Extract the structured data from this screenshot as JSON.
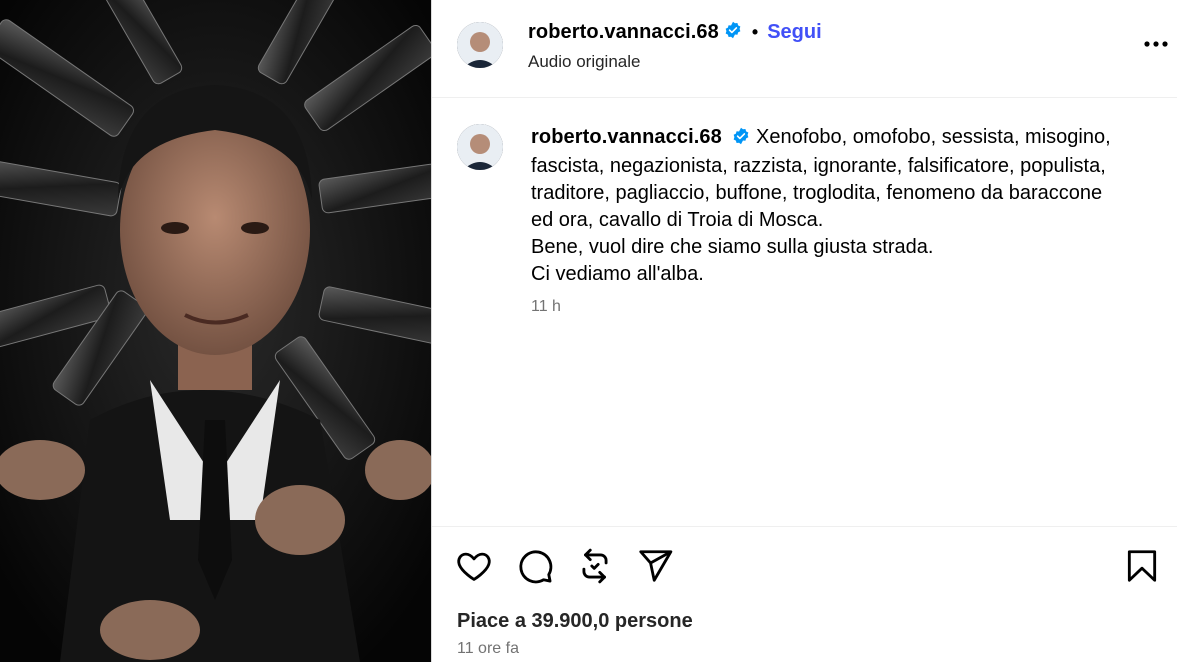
{
  "post": {
    "username": "roberto.vannacci.68",
    "follow_label": "Segui",
    "separator": "•",
    "audio_label": "Audio originale"
  },
  "caption": {
    "username": "roberto.vannacci.68",
    "lines": [
      "Xenofobo, omofobo, sessista, misogino,",
      "fascista, negazionista, razzista, ignorante, falsificatore, populista,",
      "traditore, pagliaccio, buffone, troglodita, fenomeno da baraccone",
      "ed ora, cavallo di Troia di Mosca.",
      "Bene, vuol dire che siamo sulla giusta strada.",
      "Ci vediamo all'alba."
    ],
    "time": "11 h"
  },
  "footer": {
    "likes": "Piace a 39.900,0 persone",
    "time_ago": "11 ore fa"
  },
  "icons": {
    "verified": "verified-badge-icon",
    "more": "more-options-icon",
    "like": "heart-icon",
    "comment": "comment-icon",
    "repost": "repost-icon",
    "share": "send-icon",
    "save": "bookmark-icon"
  },
  "colors": {
    "follow": "#4150f7",
    "verified": "#0095f6",
    "muted": "#737373"
  }
}
